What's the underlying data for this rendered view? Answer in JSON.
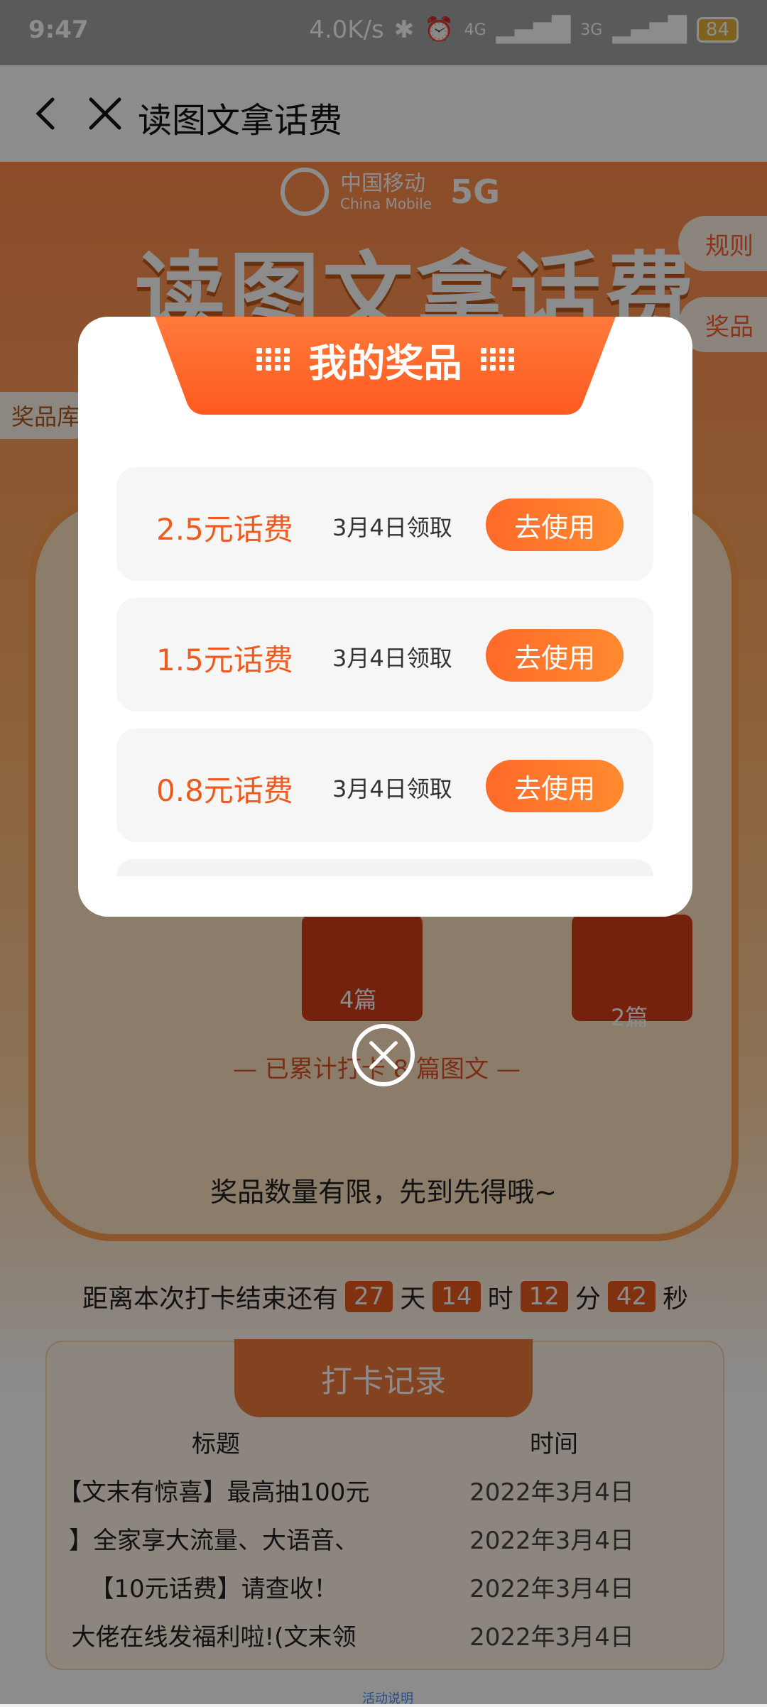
{
  "status_bar": {
    "time": "9:47",
    "speed": "4.0K/s",
    "net1": "4G",
    "net2": "3G",
    "battery": "84"
  },
  "navbar": {
    "title": "读图文拿话费"
  },
  "header": {
    "brand_cn": "中国移动",
    "brand_en": "China Mobile",
    "brand_5g": "5G",
    "main_title": "读图文拿话费",
    "rules": "规则",
    "prizes_tab": "奖品",
    "prize_shelf": "奖品库"
  },
  "progress": {
    "box_labels": [
      "4篇",
      "2篇"
    ],
    "accumulated": "— 已累计打卡 8 篇图文 —"
  },
  "notice": "奖品数量有限，先到先得哦~",
  "countdown": {
    "prefix": "距离本次打卡结束还有",
    "days": "27",
    "days_unit": "天",
    "hours": "14",
    "hours_unit": "时",
    "minutes": "12",
    "minutes_unit": "分",
    "seconds": "42",
    "seconds_unit": "秒"
  },
  "record": {
    "title": "打卡记录",
    "col_title": "标题",
    "col_time": "时间",
    "rows": [
      {
        "title": "【文末有惊喜】最高抽100元",
        "time": "2022年3月4日"
      },
      {
        "title": "】全家享大流量、大语音、",
        "time": "2022年3月4日"
      },
      {
        "title": "【10元话费】请查收！",
        "time": "2022年3月4日"
      },
      {
        "title": "大佬在线发福利啦!(文末领",
        "time": "2022年3月4日"
      }
    ]
  },
  "bottom_link": "活动说明",
  "modal": {
    "title": "我的奖品",
    "prizes": [
      {
        "name": "2.5元话费",
        "date": "3月4日领取",
        "action": "去使用"
      },
      {
        "name": "1.5元话费",
        "date": "3月4日领取",
        "action": "去使用"
      },
      {
        "name": "0.8元话费",
        "date": "3月4日领取",
        "action": "去使用"
      }
    ]
  }
}
